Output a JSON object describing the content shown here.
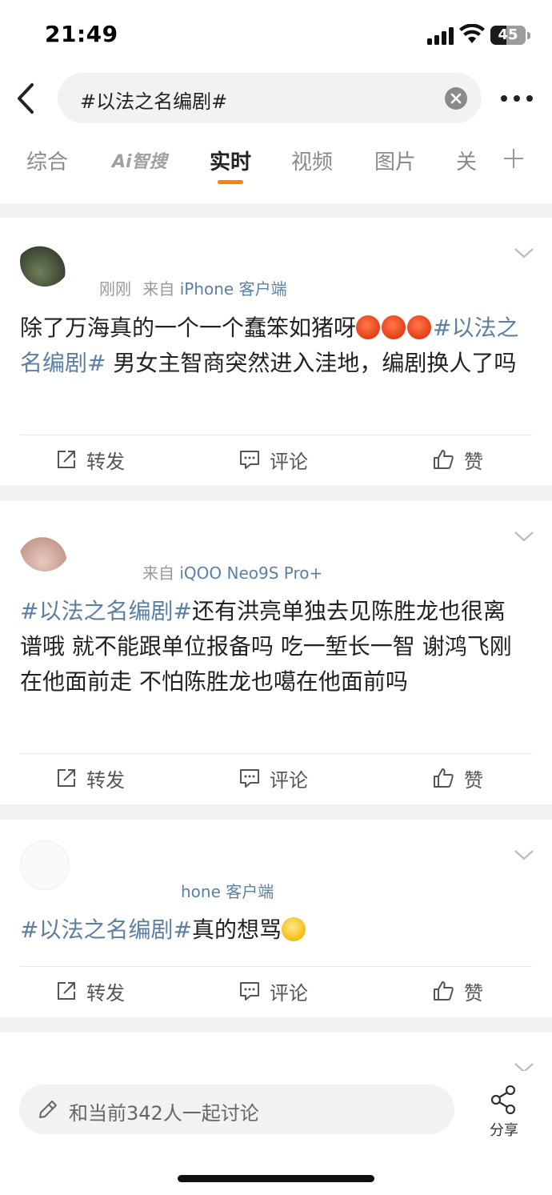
{
  "status_bar": {
    "time": "21:49",
    "battery": "45",
    "battery_level": 0.45
  },
  "search": {
    "query": "#以法之名编剧#"
  },
  "tabs": [
    {
      "label": "综合"
    },
    {
      "label": "Ai智搜"
    },
    {
      "label": "实时"
    },
    {
      "label": "视频"
    },
    {
      "label": "图片"
    },
    {
      "label": "关"
    }
  ],
  "posts": [
    {
      "time": "刚刚",
      "source": "来自",
      "client": "iPhone 客户端",
      "text": "除了万海真的一个一个蠢笨如猪呀",
      "emoji": [
        "angry-face",
        "angry-face",
        "angry-face"
      ],
      "tag": "#以法之名编剧#",
      "text_after": " 男女主智商突然进入洼地，编剧换人了吗",
      "actions": {
        "repost": "转发",
        "comment": "评论",
        "like": "赞"
      }
    },
    {
      "time": "",
      "source": "来自",
      "client": "iQOO Neo9S Pro+",
      "tag": "#以法之名编剧#",
      "text_after": "还有洪亮单独去见陈胜龙也很离谱哦  就不能跟单位报备吗  吃一堑长一智  谢鸿飞刚在他面前走  不怕陈胜龙也噶在他面前吗",
      "actions": {
        "repost": "转发",
        "comment": "评论",
        "like": "赞"
      }
    },
    {
      "meta": "hone 客户端",
      "tag": "#以法之名编剧#",
      "text_after": "真的想骂",
      "emoji": [
        "smile-face"
      ],
      "actions": {
        "repost": "转发",
        "comment": "评论",
        "like": "赞"
      }
    }
  ],
  "bottom_bar": {
    "placeholder": "和当前342人一起讨论",
    "share_label": "分享"
  },
  "colors": {
    "accent": "#ff8200",
    "link": "#5c7fa6"
  }
}
